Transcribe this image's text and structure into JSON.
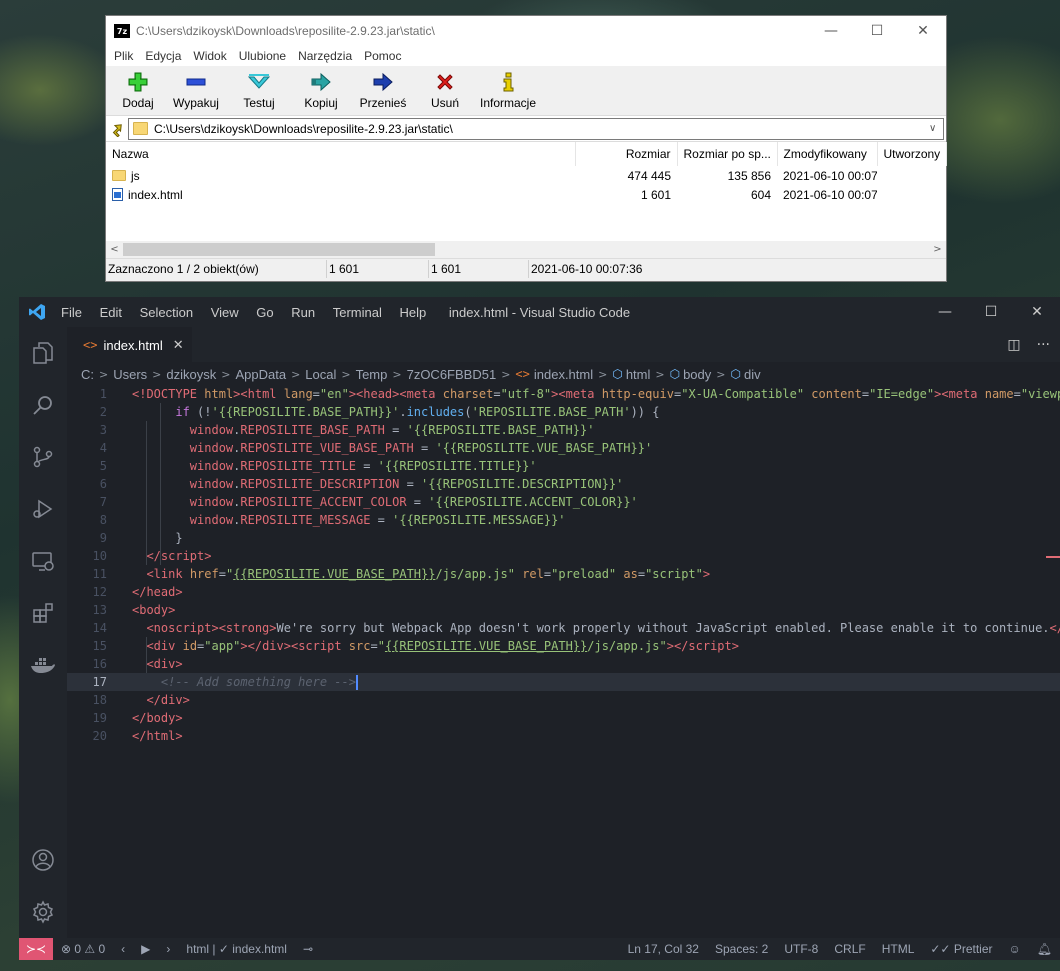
{
  "zip": {
    "title": "C:\\Users\\dzikoysk\\Downloads\\reposilite-2.9.23.jar\\static\\",
    "app_icon_text": "7z",
    "menu": [
      "Plik",
      "Edycja",
      "Widok",
      "Ulubione",
      "Narzędzia",
      "Pomoc"
    ],
    "toolbar": {
      "add": "Dodaj",
      "extract": "Wypakuj",
      "test": "Testuj",
      "copy": "Kopiuj",
      "move": "Przenieś",
      "delete": "Usuń",
      "info": "Informacje"
    },
    "address": "C:\\Users\\dzikoysk\\Downloads\\reposilite-2.9.23.jar\\static\\",
    "columns": {
      "name": "Nazwa",
      "size": "Rozmiar",
      "packed": "Rozmiar po sp...",
      "modified": "Zmodyfikowany",
      "created": "Utworzony"
    },
    "rows": [
      {
        "name": "js",
        "size": "474 445",
        "packed": "135 856",
        "modified": "2021-06-10 00:07",
        "created": ""
      },
      {
        "name": "index.html",
        "size": "1 601",
        "packed": "604",
        "modified": "2021-06-10 00:07",
        "created": ""
      }
    ],
    "status": {
      "selection": "Zaznaczono 1 / 2 obiekt(ów)",
      "size": "1 601",
      "packed": "1 601",
      "date": "2021-06-10 00:07:36"
    }
  },
  "vscode": {
    "menu": [
      "File",
      "Edit",
      "Selection",
      "View",
      "Go",
      "Run",
      "Terminal",
      "Help"
    ],
    "title": "index.html - Visual Studio Code",
    "tab": {
      "label": "index.html"
    },
    "breadcrumbs": [
      "C:",
      "Users",
      "dzikoysk",
      "AppData",
      "Local",
      "Temp",
      "7zOC6FBBD51",
      "index.html",
      "html",
      "body",
      "div"
    ],
    "line_numbers": [
      "1",
      "2",
      "3",
      "4",
      "5",
      "6",
      "7",
      "8",
      "9",
      "10",
      "11",
      "12",
      "13",
      "14",
      "15",
      "16",
      "17",
      "18",
      "19",
      "20"
    ],
    "status": {
      "problems": "⊗ 0 ⚠ 0",
      "breadcrumb": "html | ✓ index.html",
      "position": "Ln 17, Col 32",
      "spaces": "Spaces: 2",
      "encoding": "UTF-8",
      "eol": "CRLF",
      "language": "HTML",
      "formatter": "✓✓ Prettier"
    }
  }
}
